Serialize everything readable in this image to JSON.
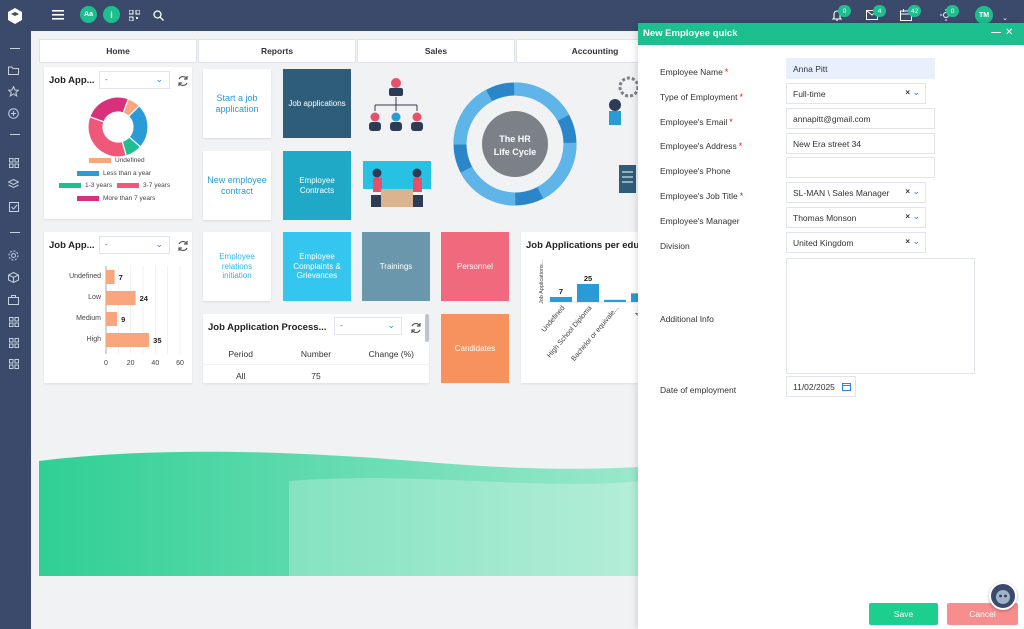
{
  "topbar": {
    "avatar_initials": "TM",
    "aa_label": "Aa",
    "info_label": "i",
    "badges": {
      "notifications": "0",
      "mail": "4",
      "calendar": "42",
      "updates": "0"
    }
  },
  "tabs": [
    {
      "label": "Home"
    },
    {
      "label": "Reports"
    },
    {
      "label": "Sales"
    },
    {
      "label": "Accounting"
    }
  ],
  "widgets": {
    "job_app_pie": {
      "title": "Job App...",
      "select_value": "-",
      "legend": [
        {
          "label": "Undefined",
          "color": "#f9a57e"
        },
        {
          "label": "Less than a year",
          "color": "#2a9bd6"
        },
        {
          "label": "1-3 years",
          "color": "#1dbf8e"
        },
        {
          "label": "3-7 years",
          "color": "#f0587a"
        },
        {
          "label": "More than 7 years",
          "color": "#d8307a"
        }
      ]
    },
    "job_app_bar": {
      "title": "Job App...",
      "select_value": "-"
    },
    "process": {
      "title": "Job Application Process...",
      "select_value": "-",
      "columns": [
        "Period",
        "Number",
        "Change (%)"
      ],
      "rows": [
        {
          "period": "All",
          "number": "75",
          "change": ""
        }
      ]
    },
    "education": {
      "title": "Job Applications per educ..."
    }
  },
  "tiles": {
    "start_job_application": "Start a job application",
    "job_applications": "Job applications",
    "new_employee_contract": "New employee contract",
    "employee_contracts": "Employee Contracts",
    "employee_relations": "Employee relations initiation",
    "complaints": "Employee Complaints & Grievances",
    "trainings": "Trainings",
    "personnel": "Personnel",
    "candidates": "Candidates",
    "lifecycle_line1": "The HR",
    "lifecycle_line2": "Life Cycle"
  },
  "chart_data": [
    {
      "type": "pie",
      "categories": [
        "Undefined",
        "Less than a year",
        "1-3 years",
        "3-7 years",
        "More than 7 years"
      ],
      "values": [
        7,
        24,
        9,
        35,
        25
      ],
      "colors": [
        "#f9a57e",
        "#2a9bd6",
        "#1dbf8e",
        "#f0587a",
        "#d8307a"
      ]
    },
    {
      "type": "bar",
      "orientation": "horizontal",
      "categories": [
        "Undefined",
        "Low",
        "Medium",
        "High"
      ],
      "values": [
        7,
        24,
        9,
        35
      ],
      "color": "#f9a57e",
      "xlim": [
        0,
        60
      ],
      "xticks": [
        "0",
        "20",
        "40",
        "60"
      ]
    },
    {
      "type": "bar",
      "categories": [
        "Undefined",
        "High School Diploma",
        "Bachelor or equivale...",
        "M..."
      ],
      "values": [
        7,
        25,
        3,
        12
      ],
      "color": "#2a9bd6",
      "ylabel": "Job Applications..."
    }
  ],
  "form": {
    "title": "New Employee quick",
    "fields": {
      "name": {
        "label": "Employee Name",
        "value": "Anna Pitt"
      },
      "type": {
        "label": "Type of Employment",
        "value": "Full-time"
      },
      "email": {
        "label": "Employee's Email",
        "value": "annapitt@gmail.com"
      },
      "address": {
        "label": "Employee's Address",
        "value": "New Era street 34"
      },
      "phone": {
        "label": "Employee's Phone",
        "value": ""
      },
      "job_title": {
        "label": "Employee's Job Title",
        "value": "SL-MAN \\ Sales Manager"
      },
      "manager": {
        "label": "Employee's Manager",
        "value": "Thomas Monson"
      },
      "division": {
        "label": "Division",
        "value": "United Kingdom"
      },
      "info": {
        "label": "Additional Info",
        "value": ""
      },
      "date": {
        "label": "Date of employment",
        "value": "11/02/2025"
      }
    },
    "save_label": "Save",
    "cancel_label": "Cancel"
  }
}
